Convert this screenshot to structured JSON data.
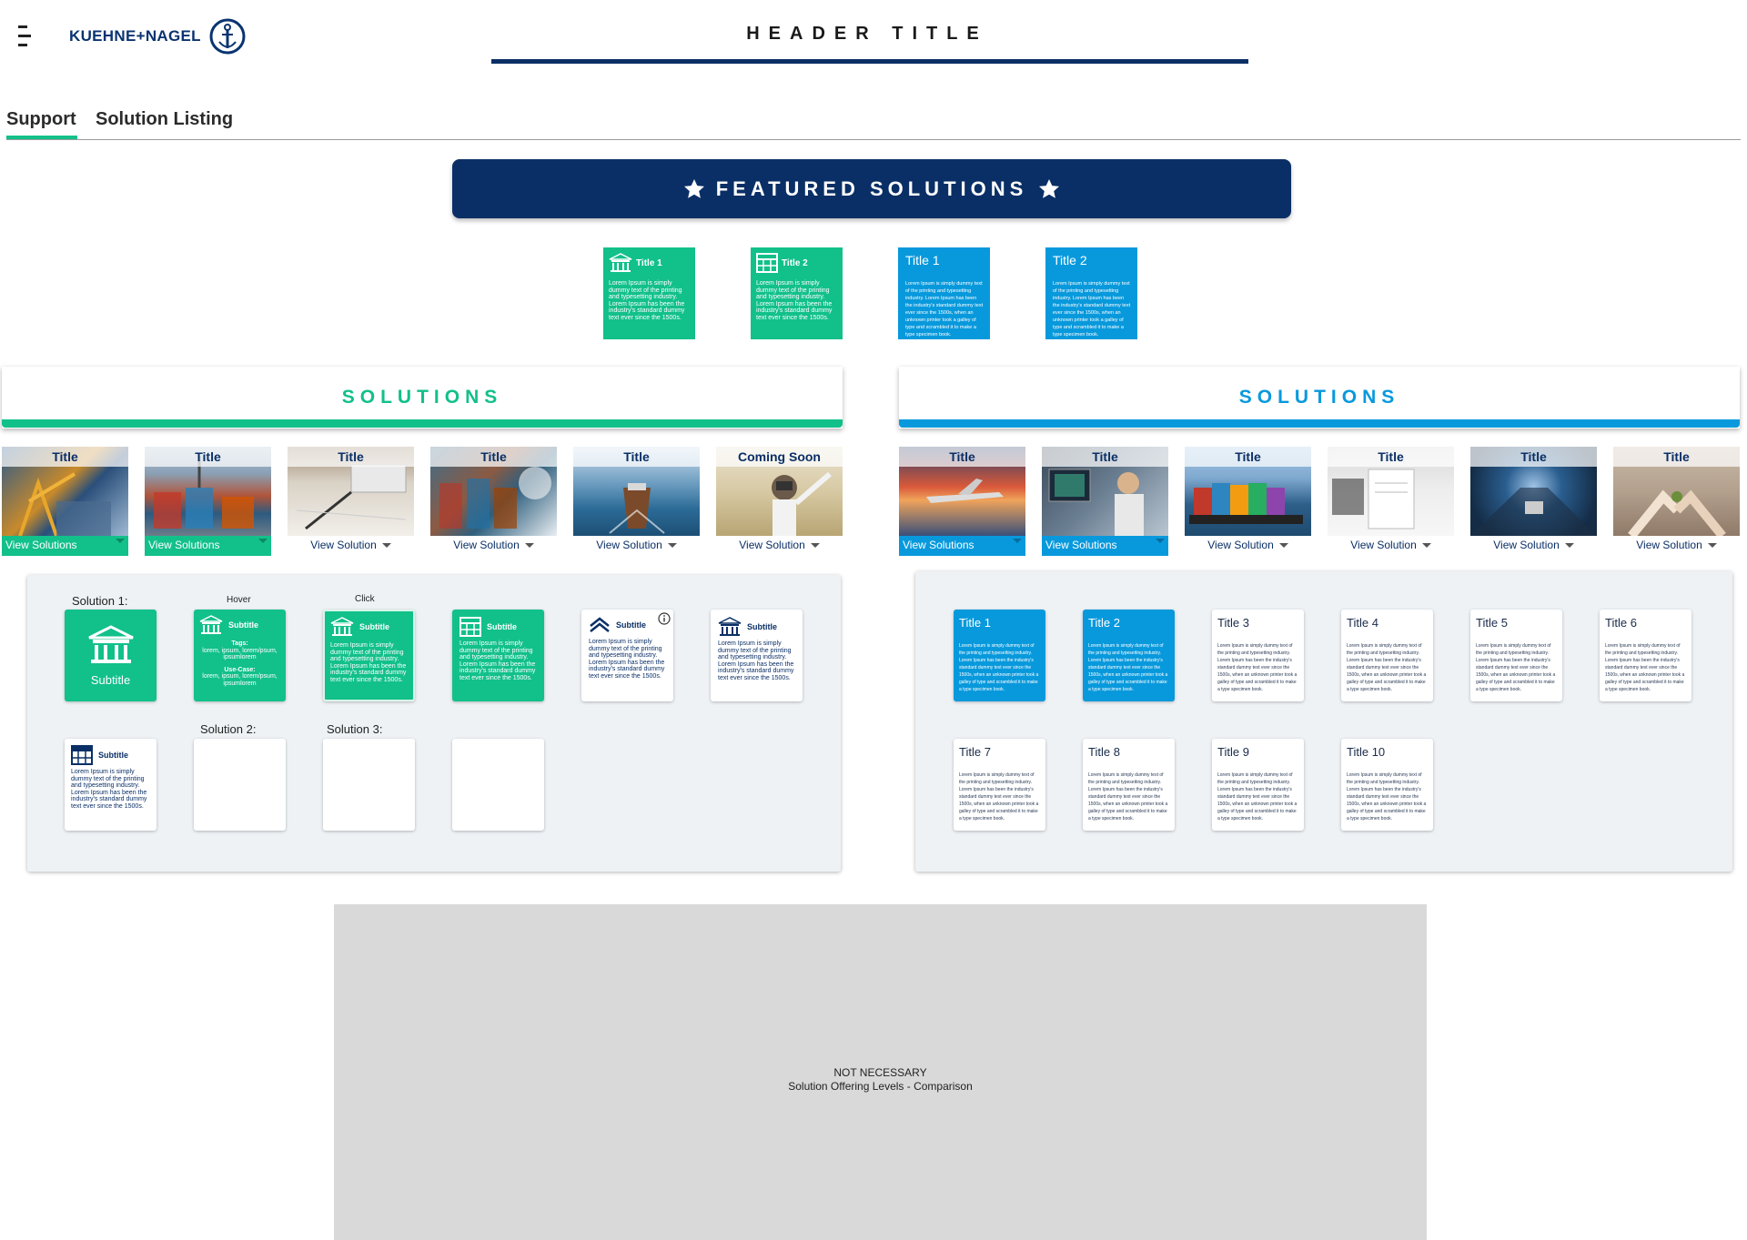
{
  "header": {
    "logo_text": "KUEHNE+NAGEL",
    "title": "HEADER TITLE"
  },
  "tabs": [
    {
      "label": "Support",
      "active": true
    },
    {
      "label": "Solution Listing",
      "active": false
    }
  ],
  "featured": {
    "banner": "FEATURED SOLUTIONS",
    "cards": [
      {
        "title": "Title 1",
        "body": "Lorem Ipsum is simply dummy text of the printing and typesetting industry. Lorem Ipsum has been the industry's standard dummy text ever since the 1500s.",
        "style": "green",
        "icon": "bank-icon"
      },
      {
        "title": "Title 2",
        "body": "Lorem Ipsum is simply dummy text of the printing and typesetting industry. Lorem Ipsum has been the industry's standard dummy text ever since the 1500s.",
        "style": "green",
        "icon": "table-icon"
      },
      {
        "title": "Title 1",
        "body": "Lorem Ipsum is simply dummy text of the printing and typesetting industry. Lorem Ipsum has been the industry's standard dummy text ever since the 1500s, when an unknown printer took a galley of type and scrambled it to make a type specimen book.",
        "style": "blue"
      },
      {
        "title": "Title 2",
        "body": "Lorem Ipsum is simply dummy text of the printing and typesetting industry. Lorem Ipsum has been the industry's standard dummy text ever since the 1500s, when an unknown printer took a galley of type and scrambled it to make a type specimen book.",
        "style": "blue"
      }
    ]
  },
  "left": {
    "heading": "SOLUTIONS",
    "accent": "#12c08a",
    "tiles": [
      {
        "title": "Title",
        "action": "View Solutions",
        "active": true
      },
      {
        "title": "Title",
        "action": "View Solutions",
        "active": true
      },
      {
        "title": "Title",
        "action": "View Solution",
        "active": false
      },
      {
        "title": "Title",
        "action": "View Solution",
        "active": false
      },
      {
        "title": "Title",
        "action": "View Solution",
        "active": false
      },
      {
        "title": "Coming Soon",
        "action": "View Solution",
        "active": false
      }
    ],
    "labels": {
      "solution1": "Solution 1:",
      "hover": "Hover",
      "click": "Click",
      "solution2": "Solution 2:",
      "solution3": "Solution 3:"
    },
    "cards": {
      "big_subtitle": "Subtitle",
      "hover_subtitle": "Subtitle",
      "hover_tags_label": "Tags:",
      "hover_tags": "lorem, ipsum, lorem/psum, ipsumlorem",
      "hover_usecase_label": "Use-Case:",
      "hover_usecase": "lorem, ipsum, lorem/psum, ipsumlorem",
      "click_subtitle": "Subtitle",
      "click_body": "Lorem Ipsum is simply dummy text of the printing and typesetting industry. Lorem Ipsum has been the industry's standard dummy text ever since the 1500s.",
      "table_subtitle": "Subtitle",
      "table_body": "Lorem Ipsum is simply dummy text of the printing and typesetting industry. Lorem Ipsum has been the industry's standard dummy text ever since the 1500s.",
      "chevron_subtitle": "Subtitle",
      "chevron_body": "Lorem Ipsum is simply dummy text of the printing and typesetting industry. Lorem Ipsum has been the industry's standard dummy text ever since the 1500s.",
      "bank_subtitle": "Subtitle",
      "bank_body": "Lorem Ipsum is simply dummy text of the printing and typesetting industry. Lorem Ipsum has been the industry's standard dummy text ever since the 1500s.",
      "row2_subtitle": "Subtitle",
      "row2_body": "Lorem Ipsum is simply dummy text of the printing and typesetting industry. Lorem Ipsum has been the industry's standard dummy text ever since the 1500s."
    }
  },
  "right": {
    "heading": "SOLUTIONS",
    "accent": "#0899dc",
    "tiles": [
      {
        "title": "Title",
        "action": "View Solutions",
        "active": true
      },
      {
        "title": "Title",
        "action": "View Solutions",
        "active": true
      },
      {
        "title": "Title",
        "action": "View Solution",
        "active": false
      },
      {
        "title": "Title",
        "action": "View Solution",
        "active": false
      },
      {
        "title": "Title",
        "action": "View Solution",
        "active": false
      },
      {
        "title": "Title",
        "action": "View Solution",
        "active": false
      }
    ],
    "cards": [
      {
        "title": "Title 1",
        "blue": true
      },
      {
        "title": "Title 2",
        "blue": true
      },
      {
        "title": "Title 3",
        "blue": false
      },
      {
        "title": "Title 4",
        "blue": false
      },
      {
        "title": "Title 5",
        "blue": false
      },
      {
        "title": "Title 6",
        "blue": false
      },
      {
        "title": "Title 7",
        "blue": false
      },
      {
        "title": "Title 8",
        "blue": false
      },
      {
        "title": "Title 9",
        "blue": false
      },
      {
        "title": "Title 10",
        "blue": false
      }
    ],
    "card_body": "Lorem Ipsum is simply dummy text of the printing and typesetting industry. Lorem Ipsum has been the industry's standard dummy text ever since the 1500s, when an unknown printer took a galley of type and scrambled it to make a type specimen book."
  },
  "placeholder": {
    "line1": "NOT NECESSARY",
    "line2": "Solution Offering Levels - Comparison"
  }
}
